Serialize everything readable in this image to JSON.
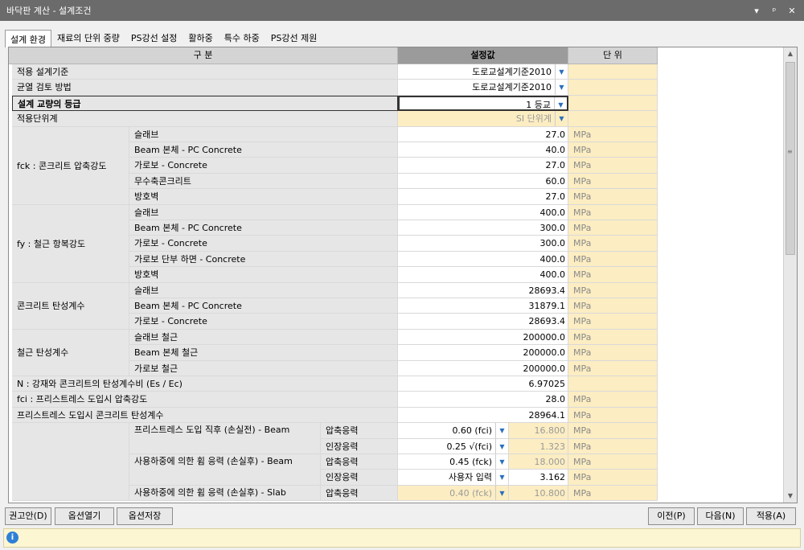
{
  "window": {
    "title": "바닥판 계산 - 설계조건",
    "controls": [
      "▾",
      "ᵖ",
      "✕"
    ]
  },
  "tabs": [
    "설계 환경",
    "재료의 단위 중량",
    "PS강선 설정",
    "활하중",
    "특수 하중",
    "PS강선 제원"
  ],
  "grid": {
    "headers": {
      "category": "구 분",
      "value": "설정값",
      "unit": "단 위"
    },
    "rows": [
      {
        "label": "적용 설계기준",
        "value": "도로교설계기준2010",
        "unit": ""
      },
      {
        "label": "균열 검토 방법",
        "value": "도로교설계기준2010",
        "unit": ""
      },
      {
        "label": "설계 교량의 등급",
        "value": "1 등교",
        "unit": ""
      },
      {
        "label": "적용단위계",
        "value": "SI 단위계",
        "unit": ""
      }
    ],
    "groups": [
      {
        "label": "fck : 콘크리트 압축강도",
        "items": [
          {
            "sub": "슬래브",
            "value": "27.0",
            "unit": "MPa"
          },
          {
            "sub": "Beam 본체 - PC Concrete",
            "value": "40.0",
            "unit": "MPa"
          },
          {
            "sub": "가로보 - Concrete",
            "value": "27.0",
            "unit": "MPa"
          },
          {
            "sub": "무수축콘크리트",
            "value": "60.0",
            "unit": "MPa"
          },
          {
            "sub": "방호벽",
            "value": "27.0",
            "unit": "MPa"
          }
        ]
      },
      {
        "label": "fy : 철근 항복강도",
        "items": [
          {
            "sub": "슬래브",
            "value": "400.0",
            "unit": "MPa"
          },
          {
            "sub": "Beam 본체 - PC Concrete",
            "value": "300.0",
            "unit": "MPa"
          },
          {
            "sub": "가로보 - Concrete",
            "value": "300.0",
            "unit": "MPa"
          },
          {
            "sub": "가로보 단부 하면 - Concrete",
            "value": "400.0",
            "unit": "MPa"
          },
          {
            "sub": "방호벽",
            "value": "400.0",
            "unit": "MPa"
          }
        ]
      },
      {
        "label": "콘크리트 탄성계수",
        "items": [
          {
            "sub": "슬래브",
            "value": "28693.4",
            "unit": "MPa"
          },
          {
            "sub": "Beam 본체 - PC Concrete",
            "value": "31879.1",
            "unit": "MPa"
          },
          {
            "sub": "가로보 - Concrete",
            "value": "28693.4",
            "unit": "MPa"
          }
        ]
      },
      {
        "label": "철근 탄성계수",
        "items": [
          {
            "sub": "슬래브 철근",
            "value": "200000.0",
            "unit": "MPa"
          },
          {
            "sub": "Beam 본체 철근",
            "value": "200000.0",
            "unit": "MPa"
          },
          {
            "sub": "가로보 철근",
            "value": "200000.0",
            "unit": "MPa"
          }
        ]
      }
    ],
    "single_rows": [
      {
        "label": "N : 강재와 콘크리트의 탄성계수비 (Es / Ec)",
        "value": "6.97025",
        "unit": ""
      },
      {
        "label": "fci : 프리스트레스 도입시 압축강도",
        "value": "28.0",
        "unit": "MPa"
      },
      {
        "label": "프리스트레스 도입시 콘크리트 탄성계수",
        "value": "28964.1",
        "unit": "MPa"
      }
    ],
    "stress": [
      {
        "group": "프리스트레스 도입 직후 (손실전) - Beam",
        "rows": [
          {
            "type": "압축응력",
            "coef": "0.60 (fci)",
            "value": "16.800",
            "unit": "MPa"
          },
          {
            "type": "인장응력",
            "coef": "0.25 √(fci)",
            "value": "1.323",
            "unit": "MPa"
          }
        ]
      },
      {
        "group": "사용하중에 의한 휨 응력 (손실후) - Beam",
        "rows": [
          {
            "type": "압축응력",
            "coef": "0.45 (fck)",
            "value": "18.000",
            "unit": "MPa"
          },
          {
            "type": "인장응력",
            "coef": "사용자 입력",
            "value": "3.162",
            "unit": "MPa"
          }
        ]
      },
      {
        "group": "사용하중에 의한 휨 응력 (손실후) - Slab",
        "rows": [
          {
            "type": "압축응력",
            "coef": "0.40 (fck)",
            "value": "10.800",
            "unit": "MPa"
          }
        ]
      }
    ]
  },
  "buttons": {
    "recommend": "권고안(D)",
    "open_option": "옵션열기",
    "save_option": "옵션저장",
    "prev": "이전(P)",
    "next": "다음(N)",
    "apply": "적용(A)"
  },
  "status": {
    "icon": "info-icon",
    "text": ""
  }
}
